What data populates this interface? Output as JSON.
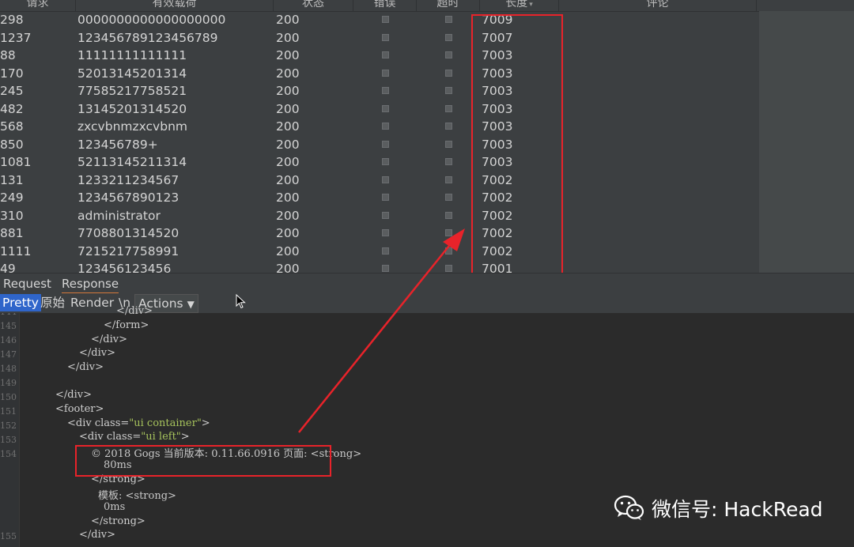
{
  "columns": {
    "request": "请求",
    "payload": "有效载荷",
    "status": "状态",
    "error": "错误",
    "timeout": "超时",
    "length": "长度",
    "length_sort_icon": "sort-descending-icon",
    "comment": "评论"
  },
  "rows": [
    {
      "request": "298",
      "payload": "0000000000000000000",
      "status": "200",
      "length": "7009"
    },
    {
      "request": "1237",
      "payload": "123456789123456789",
      "status": "200",
      "length": "7007"
    },
    {
      "request": "88",
      "payload": "11111111111111",
      "status": "200",
      "length": "7003"
    },
    {
      "request": "170",
      "payload": "52013145201314",
      "status": "200",
      "length": "7003"
    },
    {
      "request": "245",
      "payload": "77585217758521",
      "status": "200",
      "length": "7003"
    },
    {
      "request": "482",
      "payload": "13145201314520",
      "status": "200",
      "length": "7003"
    },
    {
      "request": "568",
      "payload": "zxcvbnmzxcvbnm",
      "status": "200",
      "length": "7003"
    },
    {
      "request": "850",
      "payload": "123456789+",
      "status": "200",
      "length": "7003"
    },
    {
      "request": "1081",
      "payload": "52113145211314",
      "status": "200",
      "length": "7003"
    },
    {
      "request": "131",
      "payload": "1233211234567",
      "status": "200",
      "length": "7002"
    },
    {
      "request": "249",
      "payload": "1234567890123",
      "status": "200",
      "length": "7002"
    },
    {
      "request": "310",
      "payload": "administrator",
      "status": "200",
      "length": "7002"
    },
    {
      "request": "881",
      "payload": "7708801314520",
      "status": "200",
      "length": "7002"
    },
    {
      "request": "1111",
      "payload": "7215217758991",
      "status": "200",
      "length": "7002"
    },
    {
      "request": "49",
      "payload": "123456123456",
      "status": "200",
      "length": "7001"
    }
  ],
  "tabs": {
    "request": "Request",
    "response": "Response",
    "active": "Response"
  },
  "view_buttons": {
    "pretty": "Pretty",
    "raw": "原始",
    "render": "Render",
    "newline": "\\n",
    "actions": "Actions"
  },
  "code": {
    "line_numbers": [
      "144",
      "145",
      "146",
      "147",
      "148",
      "149",
      "150",
      "151",
      "152",
      "153",
      "154",
      "",
      "",
      "",
      "",
      "",
      "155"
    ],
    "l144": "</div>",
    "l145": "</form>",
    "l146": "</div>",
    "l147": "</div>",
    "l148": "</div>",
    "l150": "</div>",
    "l151": "<footer>",
    "l152_open": "<div class=",
    "l152_val": "\"ui container\"",
    "l152_close": ">",
    "l153_open": "<div class=",
    "l153_val": "\"ui left\"",
    "l153_close": ">",
    "l154": "© 2018 Gogs 当前版本: 0.11.66.0916 页面: <strong>",
    "l154b": "80ms",
    "l154c": "</strong>",
    "l154d": "模板: <strong>",
    "l154e": "0ms",
    "l154f": "</strong>",
    "l155": "</div>"
  },
  "watermark": {
    "icon": "wechat-icon",
    "text": "微信号: HackRead"
  },
  "colors": {
    "highlight": "#e8232a",
    "active_tab": "#d4783b",
    "pretty_button": "#2f65ca"
  }
}
